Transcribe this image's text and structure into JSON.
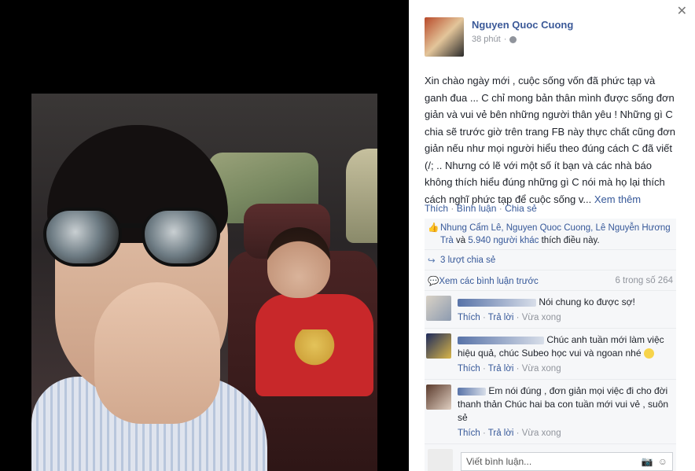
{
  "post": {
    "author": "Nguyen Quoc Cuong",
    "time": "38 phút",
    "text": "Xin chào ngày mới , cuộc sống vốn đã phức tạp và ganh đua ... C chỉ mong bản thân mình được sống đơn giản và vui vẻ bên những người thân yêu ! Những gì C chia sẽ trước giờ trên trang FB này thực chất cũng đơn giản nếu như mọi người hiểu theo đúng cách C đã viết (/; .. Nhưng có lẽ với một số ít bạn và các nhà báo không thích hiểu đúng những gì C nói mà họ lại thích cách nghĩ phức tạp để cuộc sống v...",
    "see_more": "Xem thêm"
  },
  "actions": {
    "like": "Thích",
    "sep1": " · ",
    "comment": "Bình luận",
    "sep2": " · ",
    "share": "Chia sẻ"
  },
  "likes": {
    "names": "Nhung Cẩm Lê, Nguyen Quoc Cuong, Lê Nguyễn Hương Trà",
    "and": " và ",
    "others": "5.940 người khác",
    "suffix": " thích điều này."
  },
  "shares": "3 lượt chia sẻ",
  "previous": {
    "label": "Xem các bình luận trước",
    "count": "6 trong số 264"
  },
  "comments": [
    {
      "text": "Nói chung ko được sợ!",
      "like": "Thích",
      "reply": "Trả lời",
      "time": "Vừa xong",
      "sep": " · "
    },
    {
      "text": "Chúc anh tuần mới làm việc hiệu quả, chúc Subeo học vui và ngoan nhé",
      "like": "Thích",
      "reply": "Trả lời",
      "time": "Vừa xong",
      "sep": " · "
    },
    {
      "text": "Em nói đúng , đơn giản mọi việc đi cho đời thanh thản Chúc hai ba con tuần mới vui vẻ , suôn sẻ",
      "like": "Thích",
      "reply": "Trả lời",
      "time": "Vừa xong",
      "sep": " · "
    }
  ],
  "composer": {
    "placeholder": "Viết bình luận..."
  },
  "icons": {
    "close": "close-icon",
    "globe": "globe-icon",
    "thumbs_up": "thumbs-up-icon",
    "share": "share-icon",
    "comment": "comment-icon",
    "camera": "camera-icon",
    "emoji": "emoji-icon"
  },
  "colors": {
    "link": "#365899",
    "author": "#3b5998",
    "muted": "#90949c"
  }
}
